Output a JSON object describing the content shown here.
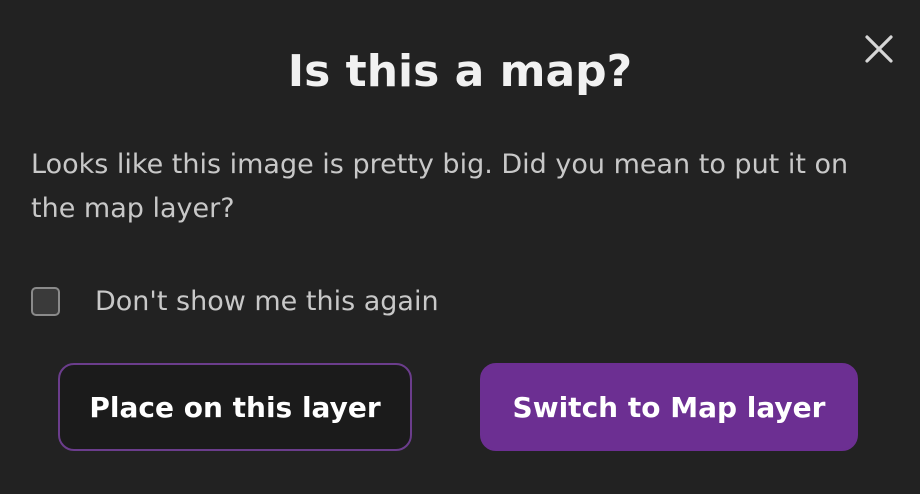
{
  "dialog": {
    "title": "Is this a map?",
    "message": "Looks like this image is pretty big. Did you mean to put it on the map layer?",
    "close_icon": "close-icon",
    "dont_show_again": {
      "label": "Don't show me this again",
      "checked": false
    },
    "buttons": {
      "place_on_layer": "Place on this layer",
      "switch_to_map": "Switch to Map layer"
    },
    "colors": {
      "background": "#222222",
      "accent": "#6c2f92",
      "secondary_border": "#6b3d8c",
      "text": "#c8c8c8",
      "title": "#f1f1f1"
    }
  }
}
